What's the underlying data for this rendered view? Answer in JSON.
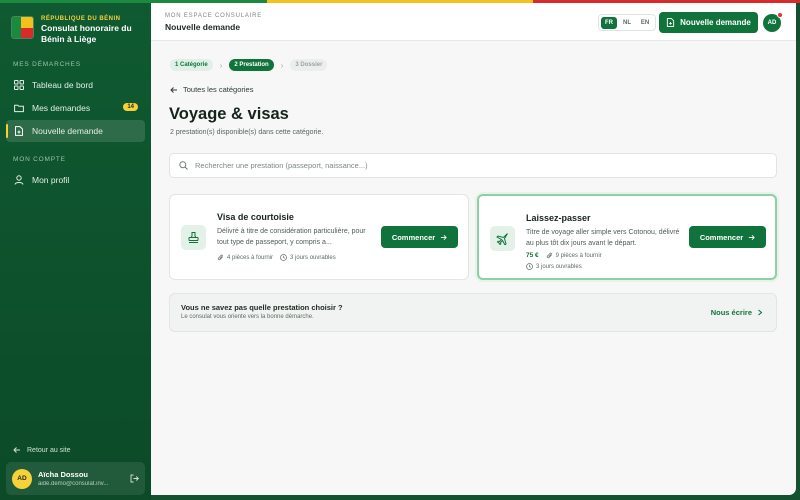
{
  "colors": {
    "brand_green": "#11733c",
    "sidebar_green": "#0f5a31",
    "accent_yellow": "#f5d23a",
    "flag_red": "#d92b2b",
    "notif_red": "#e03232"
  },
  "sidebar": {
    "country": "RÉPUBLIQUE DU BÉNIN",
    "consulate": "Consulat honoraire du Bénin à Liège",
    "sections": {
      "demarches": "MES DÉMARCHES",
      "compte": "MON COMPTE"
    },
    "items": [
      {
        "label": "Tableau de bord",
        "icon": "dashboard-icon"
      },
      {
        "label": "Mes demandes",
        "icon": "folder-icon",
        "badge": "14"
      },
      {
        "label": "Nouvelle demande",
        "icon": "new-document-icon",
        "active": true
      },
      {
        "label": "Mon profil",
        "icon": "user-icon"
      }
    ],
    "back_to_site": "Retour au site",
    "user": {
      "initials": "AD",
      "name": "Aïcha Dossou",
      "email": "aide.demo@consulat.inv..."
    }
  },
  "topbar": {
    "section": "MON ESPACE CONSULAIRE",
    "title": "Nouvelle demande",
    "languages": [
      "FR",
      "NL",
      "EN"
    ],
    "active_language": "FR",
    "new_request_label": "Nouvelle demande",
    "avatar_initials": "AD"
  },
  "stepper": [
    {
      "label": "1  Catégorie",
      "state": "done"
    },
    {
      "label": "2  Prestation",
      "state": "current"
    },
    {
      "label": "3  Dossier",
      "state": "todo"
    }
  ],
  "main": {
    "back_link": "Toutes les catégories",
    "title": "Voyage & visas",
    "subtitle": "2 prestation(s) disponible(s) dans cette catégorie.",
    "search_placeholder": "Rechercher une prestation (passeport, naissance...)"
  },
  "services": [
    {
      "title": "Visa de courtoisie",
      "description": "Délivré à titre de considération particulière, pour tout type de passeport, y compris a...",
      "icon": "stamp-icon",
      "pieces": "4 pièces à fournir",
      "delay": "3 jours ouvrables",
      "button": "Commencer"
    },
    {
      "title": "Laissez-passer",
      "description": "Titre de voyage aller simple vers Cotonou, délivré au plus tôt dix jours avant le départ.",
      "icon": "plane-icon",
      "price": "75 €",
      "pieces": "9 pièces à fournir",
      "delay": "3 jours ouvrables",
      "button": "Commencer"
    }
  ],
  "help": {
    "title": "Vous ne savez pas quelle prestation choisir ?",
    "subtitle": "Le consulat vous oriente vers la bonne démarche.",
    "link": "Nous écrire"
  }
}
